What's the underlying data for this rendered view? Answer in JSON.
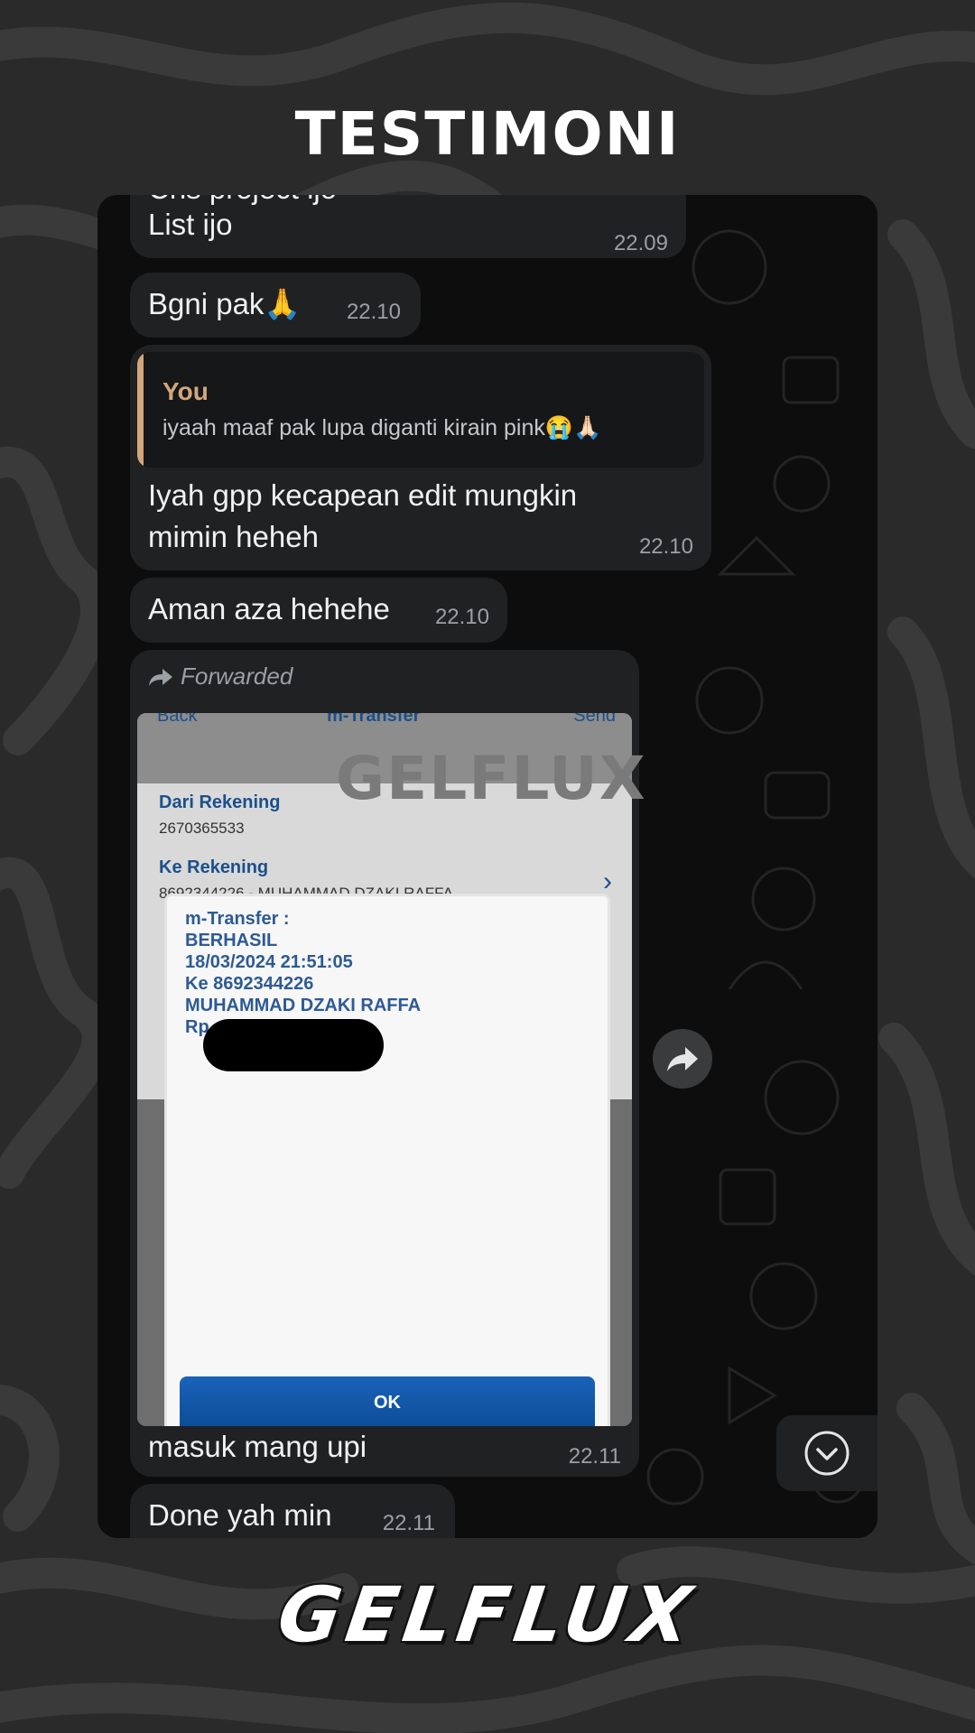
{
  "header": {
    "title": "TESTIMONI"
  },
  "chat": {
    "messages": [
      {
        "text_partial": "Chs project ijo",
        "text": "List ijo",
        "time": "22.09"
      },
      {
        "text": "Bgni pak🙏",
        "time": "22.10"
      },
      {
        "reply": {
          "name": "You",
          "text": "iyaah maaf pak lupa diganti kirain pink😭🙏🏻"
        },
        "text_line1": "Iyah gpp kecapean edit mungkin",
        "text_line2": "mimin heheh",
        "time": "22.10"
      },
      {
        "text": "Aman aza hehehe",
        "time": "22.10"
      },
      {
        "forwarded_label": "Forwarded",
        "caption": "masuk mang upi",
        "time": "22.11",
        "image": {
          "top_bar": {
            "back": "Back",
            "title": "m-Transfer",
            "send": "Send"
          },
          "from_label": "Dari Rekening",
          "from_value": "2670365533",
          "to_label": "Ke Rekening",
          "to_value": "8692344226 - MUHAMMAD DZAKI RAFFA",
          "dialog_lines": [
            "m-Transfer :",
            "BERHASIL",
            "18/03/2024 21:51:05",
            "Ke 8692344226",
            "MUHAMMAD DZAKI RAFFA",
            "Rp"
          ],
          "ok_label": "OK"
        }
      },
      {
        "text": "Done yah min",
        "time": "22.11"
      }
    ],
    "watermark": "GELFLUX"
  },
  "footer": {
    "logo_text": "GELFLUX"
  },
  "icons": [
    "forward-arrow-icon",
    "share-icon",
    "scroll-down-icon"
  ],
  "colors": {
    "reply_accent": "#d3a67c",
    "bubble": "#1f2123",
    "time": "#9aa0a3"
  }
}
